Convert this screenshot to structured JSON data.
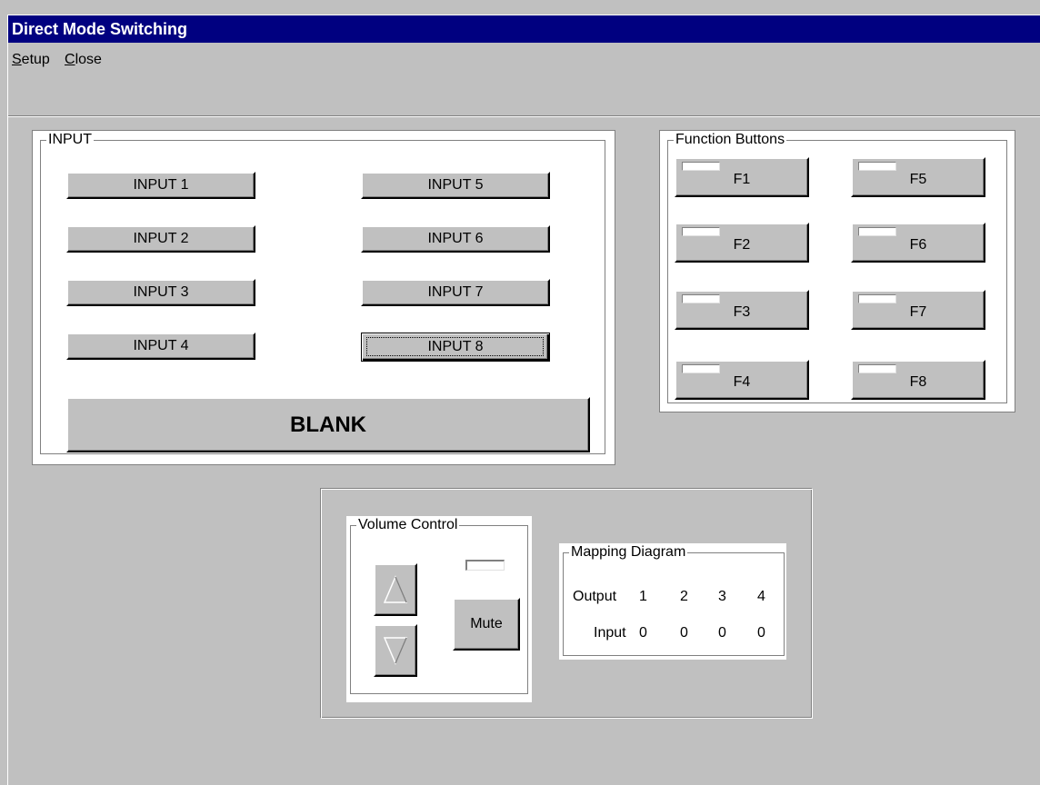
{
  "window": {
    "title": "Direct Mode Switching"
  },
  "menu": {
    "setup": {
      "accel": "S",
      "rest": "etup"
    },
    "close": {
      "accel": "C",
      "rest": "lose"
    }
  },
  "input_group": {
    "label": "INPUT",
    "buttons": [
      "INPUT 1",
      "INPUT 2",
      "INPUT 3",
      "INPUT 4",
      "INPUT 5",
      "INPUT 6",
      "INPUT 7",
      "INPUT 8"
    ],
    "focused": "INPUT 8",
    "blank": "BLANK"
  },
  "function_group": {
    "label": "Function Buttons",
    "buttons": [
      "F1",
      "F2",
      "F3",
      "F4",
      "F5",
      "F6",
      "F7",
      "F8"
    ]
  },
  "volume_group": {
    "label": "Volume Control",
    "up_icon": "up-triangle",
    "down_icon": "down-triangle",
    "mute": "Mute"
  },
  "mapping_group": {
    "label": "Mapping Diagram",
    "output_label": "Output",
    "input_label": "Input",
    "outputs": [
      "1",
      "2",
      "3",
      "4"
    ],
    "inputs": [
      "0",
      "0",
      "0",
      "0"
    ]
  },
  "colors": {
    "title_bar": "#000080",
    "face": "#c0c0c0",
    "panel": "#ffffff"
  }
}
